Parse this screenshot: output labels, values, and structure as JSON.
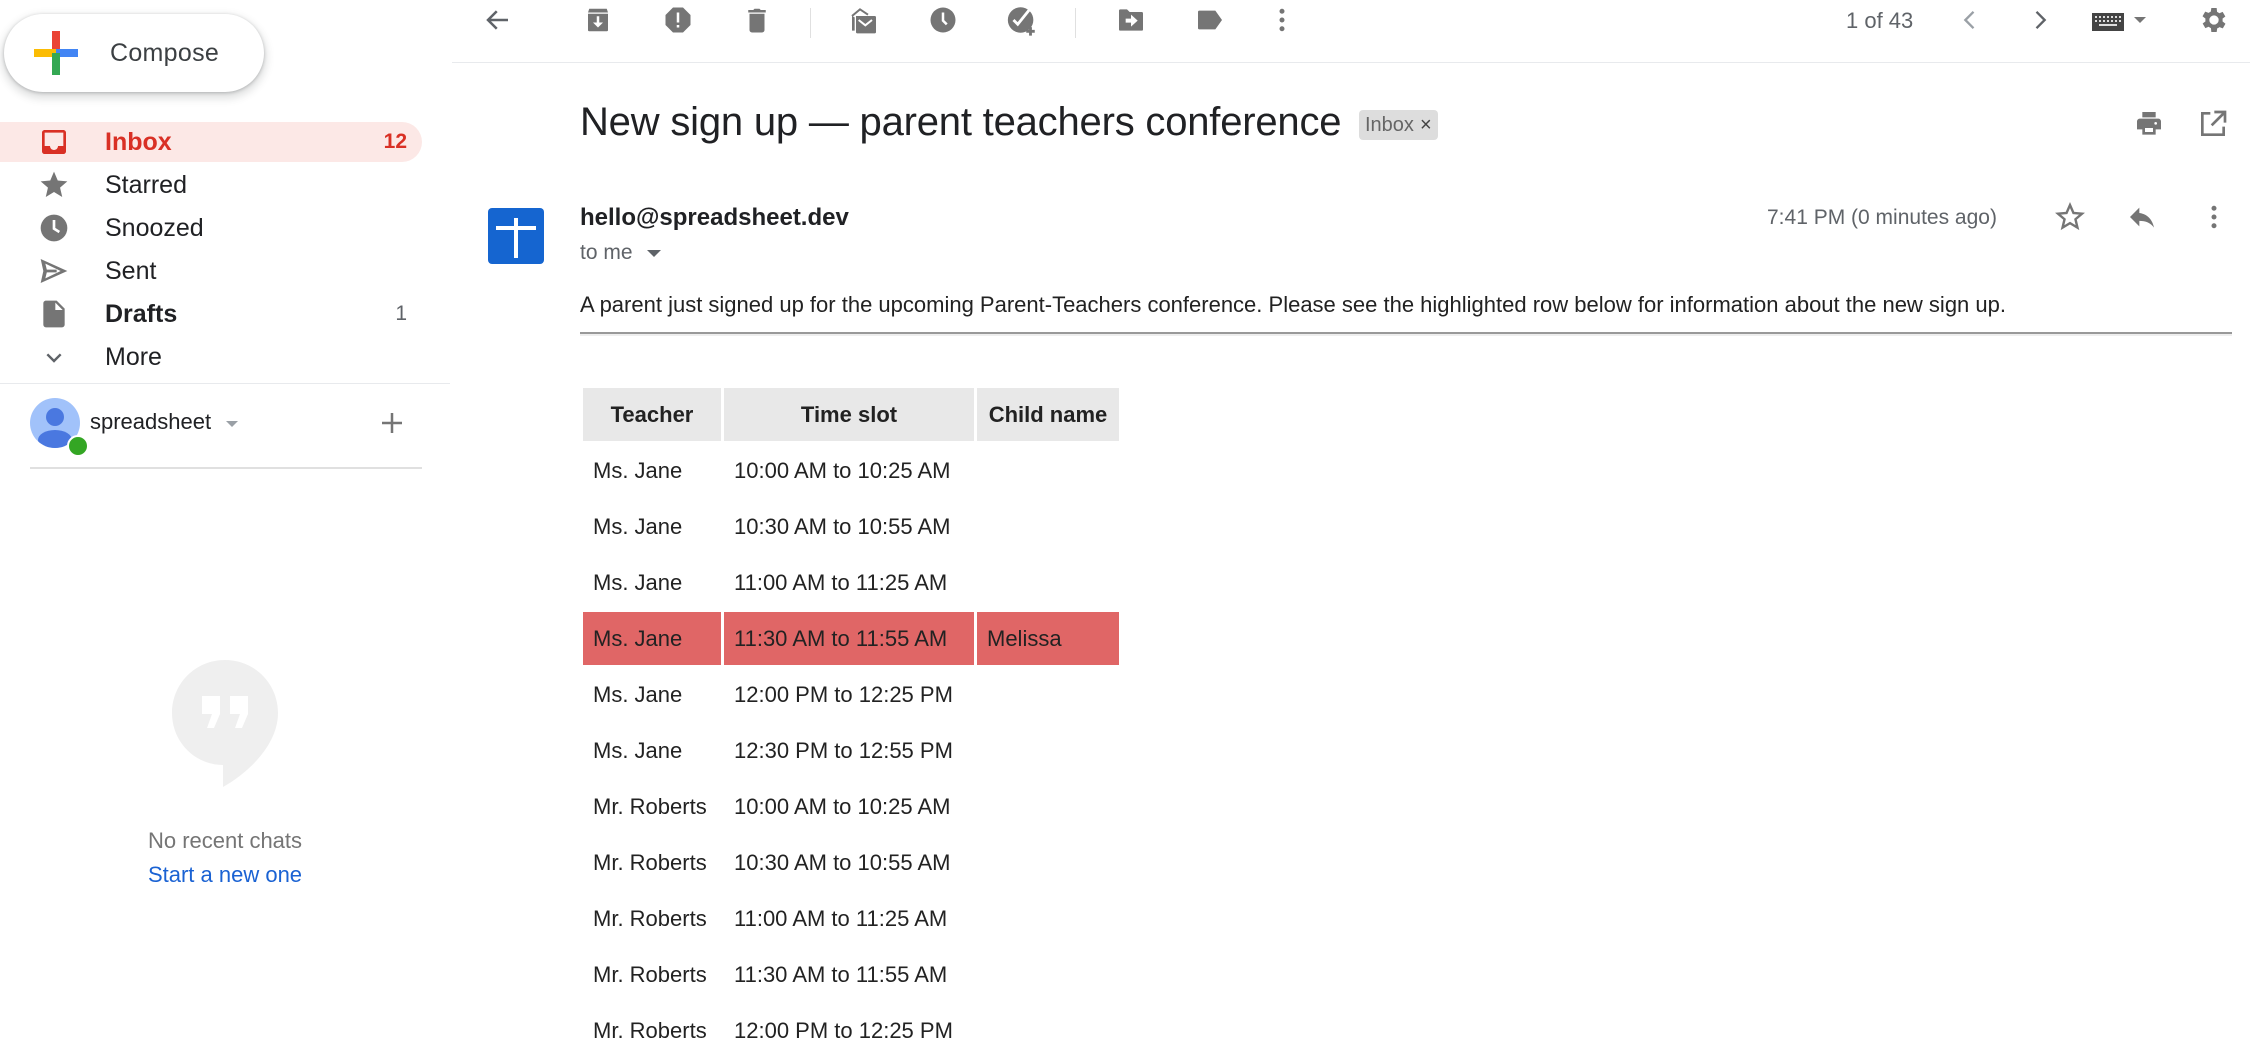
{
  "sidebar": {
    "compose_label": "Compose",
    "items": [
      {
        "label": "Inbox",
        "count": "12",
        "icon": "inbox-icon",
        "active": true
      },
      {
        "label": "Starred",
        "count": "",
        "icon": "star-icon"
      },
      {
        "label": "Snoozed",
        "count": "",
        "icon": "clock-icon"
      },
      {
        "label": "Sent",
        "count": "",
        "icon": "send-icon"
      },
      {
        "label": "Drafts",
        "count": "1",
        "icon": "draft-icon",
        "bold": true
      },
      {
        "label": "More",
        "count": "",
        "icon": "chevron-down-icon"
      }
    ],
    "account": {
      "name": "spreadsheet",
      "status": "online"
    },
    "chat": {
      "empty_text": "No recent chats",
      "start_link": "Start a new one"
    }
  },
  "toolbar": {
    "buttons": [
      "back-arrow",
      "archive",
      "report-spam",
      "delete",
      "mark-unread",
      "snooze",
      "add-to-tasks",
      "move-to",
      "labels",
      "more"
    ],
    "pager": "1 of 43",
    "input_tools": "keyboard",
    "settings": "settings"
  },
  "message": {
    "subject": "New sign up — parent teachers conference",
    "label_chip": "Inbox",
    "label_chip_remove": "×",
    "sender": "hello@spreadsheet.dev",
    "recipient": "to me",
    "timestamp": "7:41 PM (0 minutes ago)",
    "body": "A parent just signed up for the upcoming Parent-Teachers conference. Please see the highlighted row below for information about the new sign up.",
    "table": {
      "headers": [
        "Teacher",
        "Time slot",
        "Child name"
      ],
      "highlight_color": "#e06666",
      "rows": [
        {
          "teacher": "Ms. Jane",
          "slot": "10:00 AM to 10:25 AM",
          "child": ""
        },
        {
          "teacher": "Ms. Jane",
          "slot": "10:30 AM to 10:55 AM",
          "child": ""
        },
        {
          "teacher": "Ms. Jane",
          "slot": "11:00 AM to 11:25 AM",
          "child": ""
        },
        {
          "teacher": "Ms. Jane",
          "slot": "11:30 AM to 11:55 AM",
          "child": "Melissa",
          "highlighted": true
        },
        {
          "teacher": "Ms. Jane",
          "slot": "12:00 PM to 12:25 PM",
          "child": ""
        },
        {
          "teacher": "Ms. Jane",
          "slot": "12:30 PM to 12:55 PM",
          "child": ""
        },
        {
          "teacher": "Mr. Roberts",
          "slot": "10:00 AM to 10:25 AM",
          "child": ""
        },
        {
          "teacher": "Mr. Roberts",
          "slot": "10:30 AM to 10:55 AM",
          "child": ""
        },
        {
          "teacher": "Mr. Roberts",
          "slot": "11:00 AM to 11:25 AM",
          "child": ""
        },
        {
          "teacher": "Mr. Roberts",
          "slot": "11:30 AM to 11:55 AM",
          "child": ""
        },
        {
          "teacher": "Mr. Roberts",
          "slot": "12:00 PM to 12:25 PM",
          "child": ""
        }
      ]
    }
  },
  "colors": {
    "accent_red": "#d93025",
    "active_bg": "#fce8e6",
    "link_blue": "#1a62d3",
    "icon_gray": "#757575"
  }
}
